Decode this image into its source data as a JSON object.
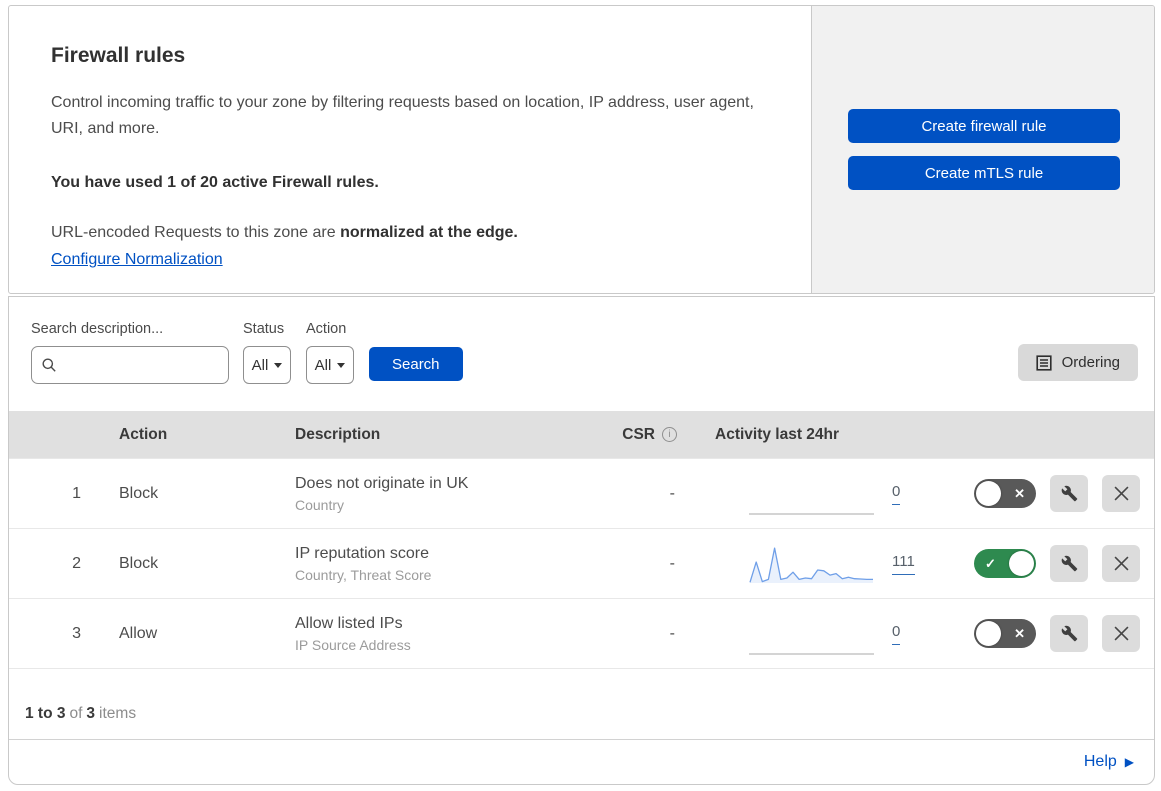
{
  "header": {
    "title": "Firewall rules",
    "description": "Control incoming traffic to your zone by filtering requests based on location, IP address, user agent, URI, and more.",
    "usage": "You have used 1 of 20 active Firewall rules.",
    "normalization_text": "URL-encoded Requests to this zone are",
    "normalization_bold": "normalized at the edge.",
    "normalization_link": "Configure Normalization",
    "create_firewall_label": "Create firewall rule",
    "create_mtls_label": "Create mTLS rule"
  },
  "filters": {
    "search_label": "Search description...",
    "search_value": "",
    "status_label": "Status",
    "status_value": "All",
    "action_label": "Action",
    "action_value": "All",
    "search_button_label": "Search",
    "ordering_button_label": "Ordering"
  },
  "table": {
    "columns": {
      "action": "Action",
      "description": "Description",
      "csr": "CSR",
      "activity": "Activity last 24hr"
    },
    "rows": [
      {
        "priority": "1",
        "action": "Block",
        "description": "Does not originate in UK",
        "fields": "Country",
        "csr": "-",
        "activity_count": "0",
        "enabled": false,
        "sparkline": []
      },
      {
        "priority": "2",
        "action": "Block",
        "description": "IP reputation score",
        "fields": "Country, Threat Score",
        "csr": "-",
        "activity_count": "111",
        "enabled": true,
        "sparkline": [
          2,
          58,
          4,
          10,
          97,
          10,
          14,
          30,
          10,
          14,
          12,
          36,
          34,
          22,
          26,
          12,
          16,
          12,
          11,
          10,
          10
        ]
      },
      {
        "priority": "3",
        "action": "Allow",
        "description": "Allow listed IPs",
        "fields": "IP Source Address",
        "csr": "-",
        "activity_count": "0",
        "enabled": false,
        "sparkline": []
      }
    ]
  },
  "footer": {
    "range": "1 to 3",
    "of_text": "of",
    "total": "3",
    "items_text": "items",
    "help_label": "Help"
  },
  "colors": {
    "primary_blue": "#0051c3",
    "toggle_on_green": "#2e8a4f",
    "toggle_off_gray": "#595959",
    "sparkline_blue": "#6f9fe8",
    "sparkline_flat_gray": "#c6c6c6"
  }
}
